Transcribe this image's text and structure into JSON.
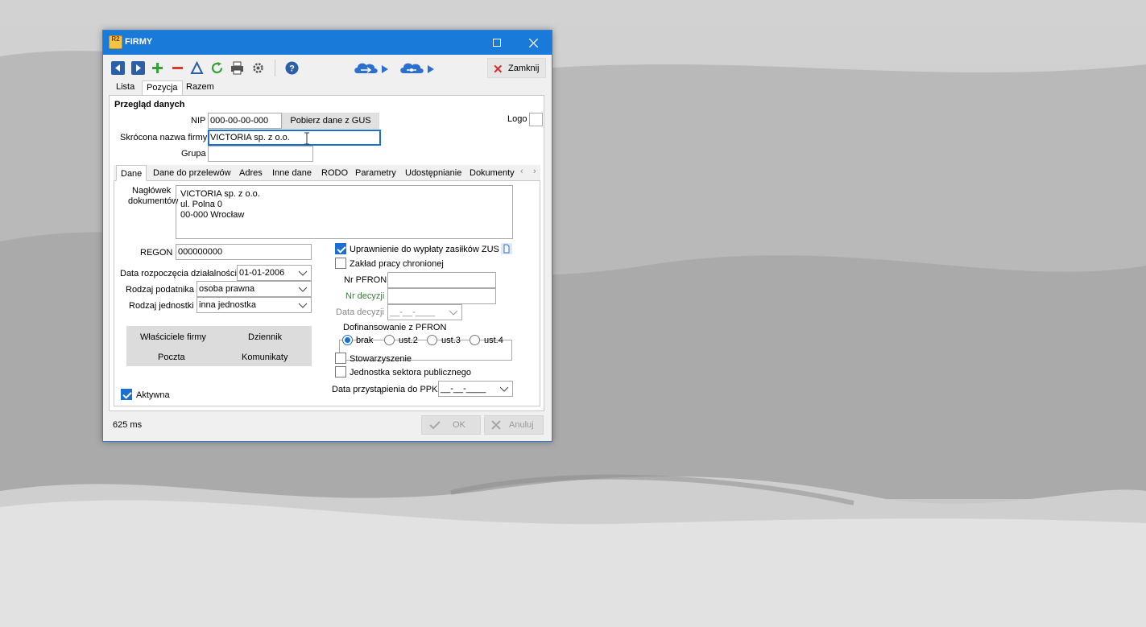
{
  "window": {
    "title": "FIRMY",
    "icon_label": "R2",
    "maximize_icon": "maximize-icon",
    "close_icon": "close-icon",
    "toolbar_icons": [
      "arrow-left-icon",
      "arrow-right-icon",
      "plus-icon",
      "minus-icon",
      "triangle-icon",
      "refresh-icon",
      "print-icon",
      "settings-icon",
      "help-icon",
      "cloud-upload-icon",
      "cloud-sync-icon"
    ],
    "close_button": "Zamknij",
    "tabs": [
      "Lista",
      "Pozycja",
      "Razem"
    ],
    "active_tab": "Pozycja"
  },
  "form": {
    "group_title": "Przegląd danych",
    "nip_label": "NIP",
    "nip_value": "000-00-00-000",
    "gus_button": "Pobierz dane z GUS",
    "logo_label": "Logo",
    "short_name_label": "Skrócona nazwa firmy",
    "short_name_value": "VICTORIA sp. z o.o.",
    "group_label": "Grupa",
    "group_value": ""
  },
  "subtabs": {
    "items": [
      "Dane",
      "Dane do przelewów",
      "Adres",
      "Inne dane",
      "RODO",
      "Parametry",
      "Udostępnianie",
      "Dokumenty"
    ],
    "active": "Dane"
  },
  "dane": {
    "header_label_1": "Nagłówek",
    "header_label_2": "dokumentów",
    "header_lines": [
      "VICTORIA sp. z o.o.",
      "ul. Polna 0",
      "00-000 Wrocław"
    ],
    "regon_label": "REGON",
    "regon_value": "000000000",
    "start_date_label": "Data rozpoczęcia działalności",
    "start_date_value": "01-01-2006",
    "taxpayer_label": "Rodzaj podatnika",
    "taxpayer_value": "osoba prawna",
    "unit_label": "Rodzaj jednostki",
    "unit_value": "inna jednostka",
    "buttons": [
      "Właściciele firmy",
      "Dziennik",
      "Poczta",
      "Komunikaty"
    ],
    "active_label": "Aktywna",
    "active_checked": true,
    "zus_label": "Uprawnienie do wypłaty zasiłków ZUS",
    "zus_checked": true,
    "protected_label": "Zakład pracy chronionej",
    "protected_checked": false,
    "pfron_label": "Nr PFRON",
    "pfron_value": "",
    "decision_no_label": "Nr decyzji",
    "decision_no_value": "",
    "decision_date_label": "Data decyzji",
    "decision_date_value": "__-__-____",
    "pfron_group_label": "Dofinansowanie z PFRON",
    "pfron_options": [
      "brak",
      "ust.2",
      "ust.3",
      "ust.4"
    ],
    "pfron_selected": "brak",
    "association_label": "Stowarzyszenie",
    "association_checked": false,
    "public_sector_label": "Jednostka sektora publicznego",
    "public_sector_checked": false,
    "ppk_label": "Data przystąpienia do PPK",
    "ppk_value": "__-__-____"
  },
  "footer": {
    "status": "625 ms",
    "ok": "OK",
    "cancel": "Anuluj"
  },
  "colors": {
    "titlebar": "#1a7ad9",
    "accent": "#1a6fd1",
    "close_x": "#d92b2b"
  }
}
